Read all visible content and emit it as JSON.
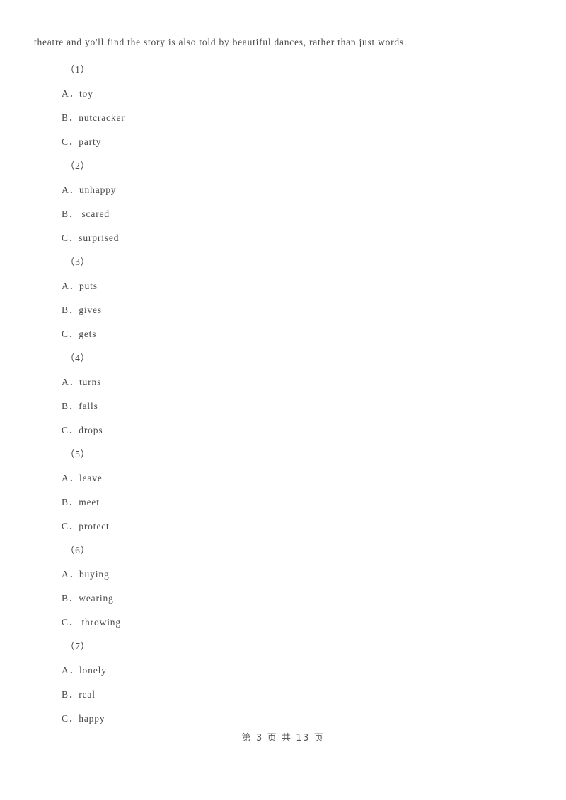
{
  "document": {
    "passage_line": "theatre and yo'll find the story is also told by beautiful dances, rather than just words.",
    "questions": [
      {
        "number": "（1）",
        "options": [
          {
            "label": "A．",
            "text": "toy"
          },
          {
            "label": "B．",
            "text": "nutcracker"
          },
          {
            "label": "C．",
            "text": "party"
          }
        ]
      },
      {
        "number": "（2）",
        "options": [
          {
            "label": "A．",
            "text": "unhappy"
          },
          {
            "label": "B．",
            "text": " scared"
          },
          {
            "label": "C．",
            "text": "surprised"
          }
        ]
      },
      {
        "number": "（3）",
        "options": [
          {
            "label": "A．",
            "text": "puts"
          },
          {
            "label": "B．",
            "text": "gives"
          },
          {
            "label": "C．",
            "text": "gets"
          }
        ]
      },
      {
        "number": "（4）",
        "options": [
          {
            "label": "A．",
            "text": "turns"
          },
          {
            "label": "B．",
            "text": "falls"
          },
          {
            "label": "C．",
            "text": "drops"
          }
        ]
      },
      {
        "number": "（5）",
        "options": [
          {
            "label": "A．",
            "text": "leave"
          },
          {
            "label": "B．",
            "text": "meet"
          },
          {
            "label": "C．",
            "text": "protect"
          }
        ]
      },
      {
        "number": "（6）",
        "options": [
          {
            "label": "A．",
            "text": "buying"
          },
          {
            "label": "B．",
            "text": "wearing"
          },
          {
            "label": "C．",
            "text": " throwing"
          }
        ]
      },
      {
        "number": "（7）",
        "options": [
          {
            "label": "A．",
            "text": "lonely"
          },
          {
            "label": "B．",
            "text": "real"
          },
          {
            "label": "C．",
            "text": "happy"
          }
        ]
      }
    ],
    "footer": "第 3 页 共 13 页"
  },
  "colors": {
    "page_background": "#ffffff",
    "body_text": "#4a4a4a",
    "footer_text": "#5a5a5a"
  }
}
